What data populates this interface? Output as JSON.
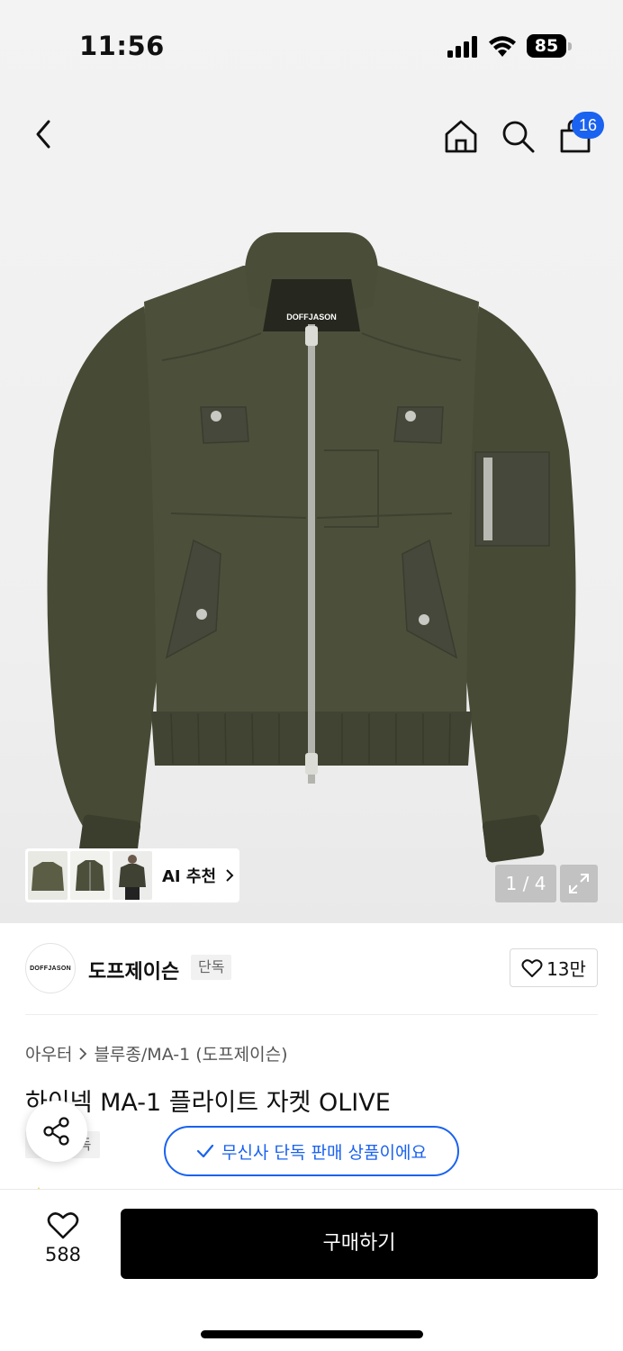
{
  "status_bar": {
    "time": "11:56",
    "battery": "85"
  },
  "header": {
    "cart_count": "16"
  },
  "gallery": {
    "page_indicator": "1 / 4",
    "ai_recommend_label": "AI 추천",
    "product_label_text": "DOFFJASON"
  },
  "brand": {
    "logo_text": "DOFFJASON",
    "name": "도프제이슨",
    "tag": "단독",
    "likes": "13만"
  },
  "product": {
    "breadcrumb": [
      "아우터",
      "블루종/MA-1 (도프제이슨)"
    ],
    "title": "하이넥 MA-1 플라이트 자켓 OLIVE",
    "sub_tag": "단독",
    "exclusive_notice": "무신사 단독 판매 상품이에요"
  },
  "bottom_bar": {
    "wish_count": "588",
    "buy_label": "구매하기"
  },
  "colors": {
    "accent": "#1a62f0",
    "olive": "#4c4f3a",
    "black": "#000000"
  }
}
